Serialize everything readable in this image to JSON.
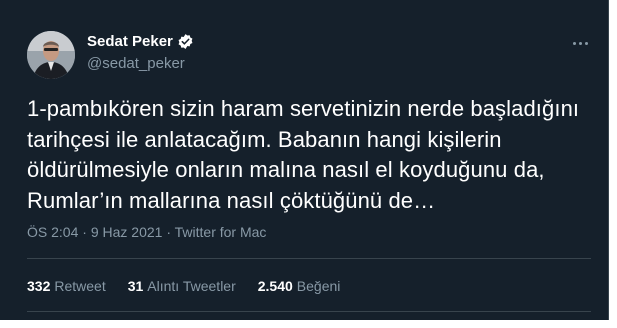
{
  "author": {
    "name": "Sedat Peker",
    "handle": "@sedat_peker",
    "verified_icon": "verified-badge-icon"
  },
  "tweet": {
    "lines": [
      "1-pambıkören sizin haram servetinizin nerde başladığını",
      "tarihçesi ile anlatacağım. Babanın hangi kişilerin",
      "öldürülmesiyle onların malına nasıl el koyduğunu da,",
      "Rumlar’ın mallarına nasıl çöktüğünü de…"
    ]
  },
  "meta": {
    "time": "ÖS 2:04",
    "sep1": " · ",
    "date": "9 Haz 2021",
    "sep2": " · ",
    "source": "Twitter for Mac"
  },
  "stats": {
    "retweets_count": "332",
    "retweets_label": "Retweet",
    "quotes_count": "31",
    "quotes_label": "Alıntı Tweetler",
    "likes_count": "2.540",
    "likes_label": "Beğeni"
  },
  "colors": {
    "background": "#15202b",
    "text": "#ffffff",
    "secondary": "#8899a6",
    "verified": "#ffffff",
    "divider": "#38444d"
  }
}
